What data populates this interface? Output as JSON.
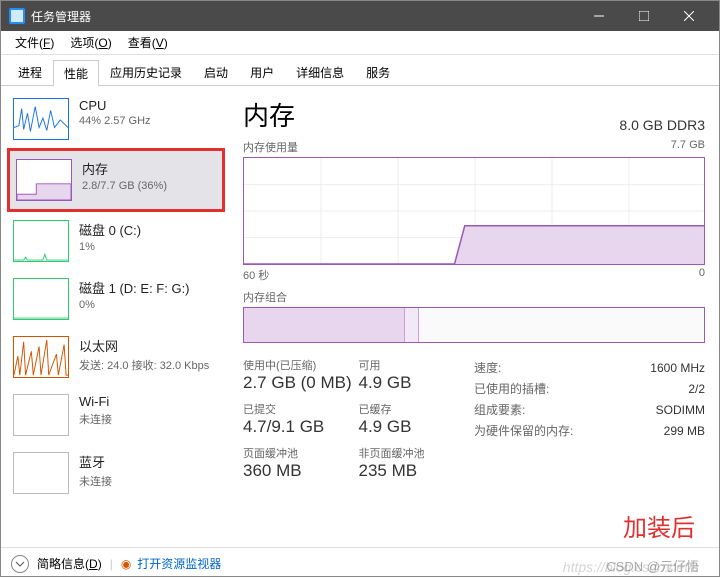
{
  "window": {
    "title": "任务管理器"
  },
  "menubar": {
    "file": {
      "label": "文件",
      "accel": "F"
    },
    "options": {
      "label": "选项",
      "accel": "O"
    },
    "view": {
      "label": "查看",
      "accel": "V"
    }
  },
  "tabs": {
    "processes": "进程",
    "performance": "性能",
    "app_history": "应用历史记录",
    "startup": "启动",
    "users": "用户",
    "details": "详细信息",
    "services": "服务"
  },
  "sidebar": {
    "cpu": {
      "name": "CPU",
      "stat": "44% 2.57 GHz"
    },
    "mem": {
      "name": "内存",
      "stat": "2.8/7.7 GB (36%)"
    },
    "disk0": {
      "name": "磁盘 0 (C:)",
      "stat": "1%"
    },
    "disk1": {
      "name": "磁盘 1 (D: E: F: G:)",
      "stat": "0%"
    },
    "eth": {
      "name": "以太网",
      "stat": "发送: 24.0 接收: 32.0 Kbps"
    },
    "wifi": {
      "name": "Wi-Fi",
      "stat": "未连接"
    },
    "bt": {
      "name": "蓝牙",
      "stat": "未连接"
    }
  },
  "detail": {
    "title": "内存",
    "spec": "8.0 GB DDR3",
    "usage_label": "内存使用量",
    "usage_max": "7.7 GB",
    "comp_label": "内存组合",
    "axis_left": "60 秒",
    "axis_right": "0",
    "stats": {
      "in_use_label": "使用中(已压缩)",
      "in_use_value": "2.7 GB (0 MB)",
      "available_label": "可用",
      "available_value": "4.9 GB",
      "committed_label": "已提交",
      "committed_value": "4.7/9.1 GB",
      "cached_label": "已缓存",
      "cached_value": "4.9 GB",
      "paged_label": "页面缓冲池",
      "paged_value": "360 MB",
      "nonpaged_label": "非页面缓冲池",
      "nonpaged_value": "235 MB"
    },
    "specs": {
      "speed_label": "速度:",
      "speed_value": "1600 MHz",
      "slots_label": "已使用的插槽:",
      "slots_value": "2/2",
      "form_label": "组成要素:",
      "form_value": "SODIMM",
      "reserved_label": "为硬件保留的内存:",
      "reserved_value": "299 MB"
    }
  },
  "chart_data": {
    "type": "area",
    "title": "内存使用量",
    "xlabel": "秒",
    "ylabel": "GB",
    "x_range_seconds": [
      60,
      0
    ],
    "ylim": [
      0,
      7.7
    ],
    "series": [
      {
        "name": "使用中",
        "x": [
          60,
          50,
          40,
          32,
          31,
          20,
          10,
          0
        ],
        "values": [
          0,
          0,
          0,
          0,
          2.8,
          2.8,
          2.8,
          2.8
        ]
      }
    ]
  },
  "footer": {
    "brief_label": "简略信息",
    "brief_accel": "D",
    "rm_link": "打开资源监视器"
  },
  "annotation": "加装后",
  "watermark_url": "https://blog.csdn.net/c",
  "watermark_user": "CSDN @元仔悟"
}
